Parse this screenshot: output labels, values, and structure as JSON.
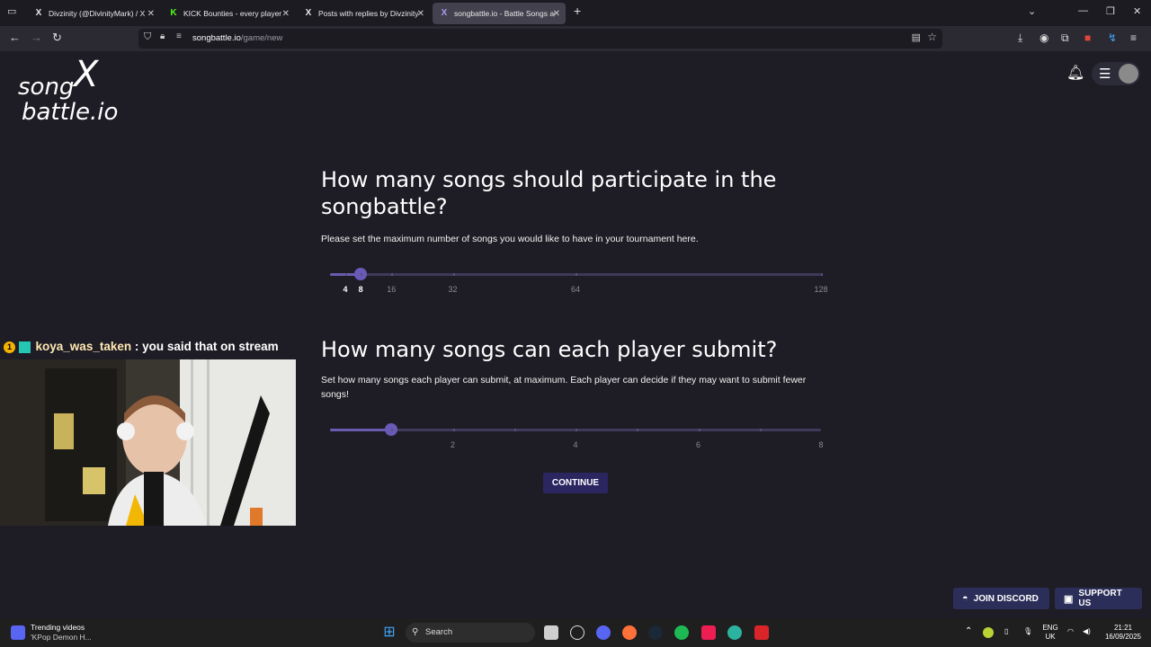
{
  "browser": {
    "tabs": [
      {
        "icon": "X",
        "title": "Divzinity (@DivinityMark) / X",
        "active": false
      },
      {
        "icon": "K",
        "title": "KICK Bounties - every player fo",
        "active": false
      },
      {
        "icon": "X",
        "title": "Posts with replies by Divzinity (",
        "active": false
      },
      {
        "icon": "X",
        "title": "songbattle.io - Battle Songs ag",
        "active": true
      }
    ],
    "url_host": "songbattle.io",
    "url_path": "/game/new"
  },
  "site": {
    "logo_line1": "song",
    "logo_line2": "battle.io"
  },
  "section1": {
    "title": "How many songs should participate in the songbattle?",
    "description": "Please set the maximum number of songs you would like to have in your tournament here.",
    "slider": {
      "value": 8,
      "marks": [
        {
          "label": "4",
          "value": 4,
          "active": true
        },
        {
          "label": "8",
          "value": 8,
          "active": true
        },
        {
          "label": "16",
          "value": 16,
          "active": false
        },
        {
          "label": "32",
          "value": 32,
          "active": false
        },
        {
          "label": "64",
          "value": 64,
          "active": false
        },
        {
          "label": "128",
          "value": 128,
          "active": false
        }
      ]
    }
  },
  "section2": {
    "title": "How many songs can each player submit?",
    "description": "Set how many songs each player can submit, at maximum. Each player can decide if they may want to submit fewer songs!",
    "slider": {
      "min": 0,
      "max": 8,
      "value": 1,
      "marks": [
        {
          "label": "2",
          "value": 2
        },
        {
          "label": "4",
          "value": 4
        },
        {
          "label": "6",
          "value": 6
        },
        {
          "label": "8",
          "value": 8
        }
      ]
    }
  },
  "continue_label": "CONTINUE",
  "join_discord_label": "JOIN DISCORD",
  "support_us_label": "SUPPORT US",
  "stream_overlay": {
    "chat_username": "koya_was_taken",
    "chat_message": ": you said that on stream"
  },
  "taskbar": {
    "trending_title": "Trending videos",
    "trending_sub": "'KPop Demon H...",
    "search_placeholder": "Search",
    "lang_top": "ENG",
    "lang_bottom": "UK",
    "time": "21:21",
    "date": "16/09/2025"
  },
  "colors": {
    "accent": "#6a5ab8",
    "button_bg": "#2b2560",
    "page_bg": "#1e1d25"
  }
}
